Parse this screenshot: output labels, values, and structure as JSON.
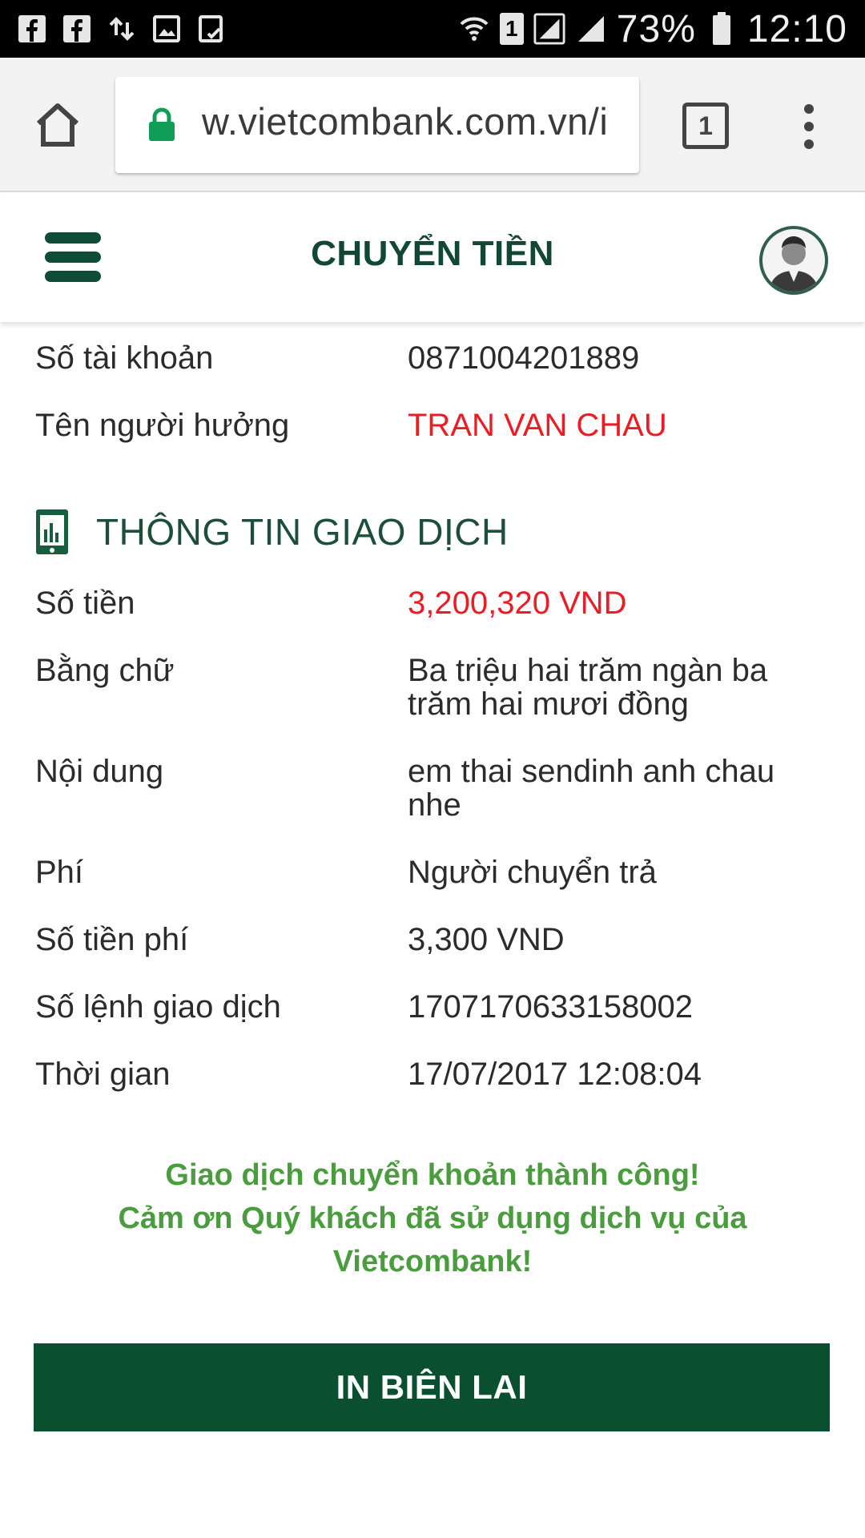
{
  "status_bar": {
    "battery": "73%",
    "time": "12:10",
    "sim_slot": "1",
    "left_icons": [
      "facebook-icon",
      "facebook-icon",
      "data-transfer-icon",
      "image-icon",
      "checklist-icon"
    ],
    "right_icons": [
      "wifi-icon",
      "sim-icon",
      "signal-icon",
      "signal-icon",
      "battery-icon"
    ]
  },
  "browser": {
    "url": "w.vietcombank.com.vn/i",
    "tab_count": "1"
  },
  "header": {
    "title": "CHUYỂN TIỀN"
  },
  "recipient": [
    {
      "label": "Số tài khoản",
      "value": "0871004201889"
    },
    {
      "label": "Tên người hưởng",
      "value": "TRAN VAN CHAU"
    }
  ],
  "transaction": {
    "title": "THÔNG TIN GIAO DỊCH",
    "rows": [
      {
        "label": "Số tiền",
        "value": "3,200,320 VND"
      },
      {
        "label": "Bằng chữ",
        "value": "Ba triệu hai trăm ngàn ba trăm hai mươi đồng"
      },
      {
        "label": "Nội dung",
        "value": "em thai sendinh anh chau nhe"
      },
      {
        "label": "Phí",
        "value": "Người chuyển trả"
      },
      {
        "label": "Số tiền phí",
        "value": "3,300 VND"
      },
      {
        "label": "Số lệnh giao dịch",
        "value": "1707170633158002"
      },
      {
        "label": "Thời gian",
        "value": "17/07/2017 12:08:04"
      }
    ]
  },
  "success_message": {
    "line1": "Giao dịch chuyển khoản thành công!",
    "line2": "Cảm ơn Quý khách đã sử dụng dịch vụ của",
    "line3": "Vietcombank!"
  },
  "print_button": "IN BIÊN LAI",
  "colors": {
    "brand_green": "#0b4f31",
    "title_green": "#124734",
    "success_green": "#4b9b3f",
    "highlight_red": "#ec1c24"
  }
}
